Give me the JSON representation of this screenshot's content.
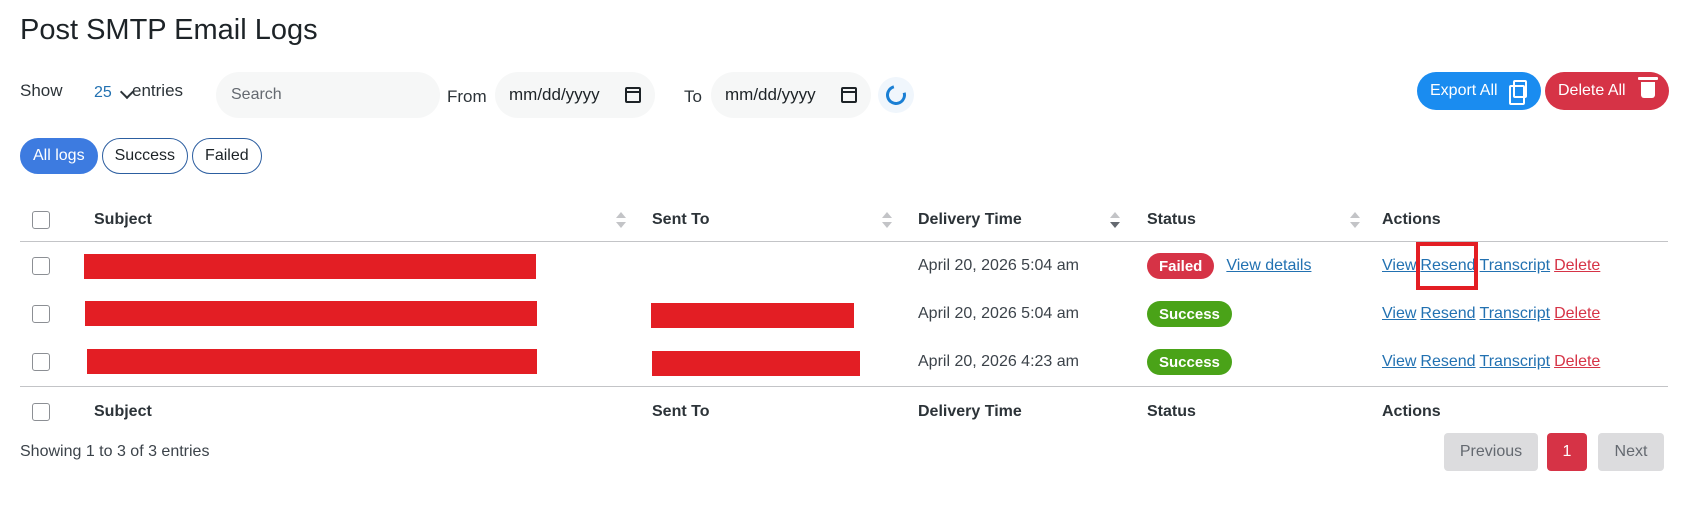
{
  "page": {
    "title": "Post SMTP Email Logs"
  },
  "toolbar": {
    "show_label": "Show",
    "entries_value": "25",
    "entries_label": "entries",
    "search_placeholder": "Search",
    "from_label": "From",
    "from_value": "mm/dd/yyyy",
    "to_label": "To",
    "to_value": "mm/dd/yyyy",
    "export_label": "Export All",
    "delete_all_label": "Delete All"
  },
  "filters": {
    "all": "All logs",
    "success": "Success",
    "failed": "Failed"
  },
  "table": {
    "headers": {
      "subject": "Subject",
      "sent_to": "Sent To",
      "delivery_time": "Delivery Time",
      "status": "Status",
      "actions": "Actions"
    },
    "rows": [
      {
        "delivery_time": "April 20, 2026 5:04 am",
        "status": "Failed",
        "view_details": "View details"
      },
      {
        "delivery_time": "April 20, 2026 5:04 am",
        "status": "Success"
      },
      {
        "delivery_time": "April 20, 2026 4:23 am",
        "status": "Success"
      }
    ],
    "actions": {
      "view": "View",
      "resend": "Resend",
      "transcript": "Transcript",
      "delete": "Delete"
    }
  },
  "footer": {
    "showing": "Showing 1 to 3 of 3 entries",
    "previous": "Previous",
    "page": "1",
    "next": "Next"
  },
  "colors": {
    "accent": "#1a8cf0",
    "danger": "#d63346",
    "success": "#4aa318",
    "redaction": "#e31e24"
  }
}
